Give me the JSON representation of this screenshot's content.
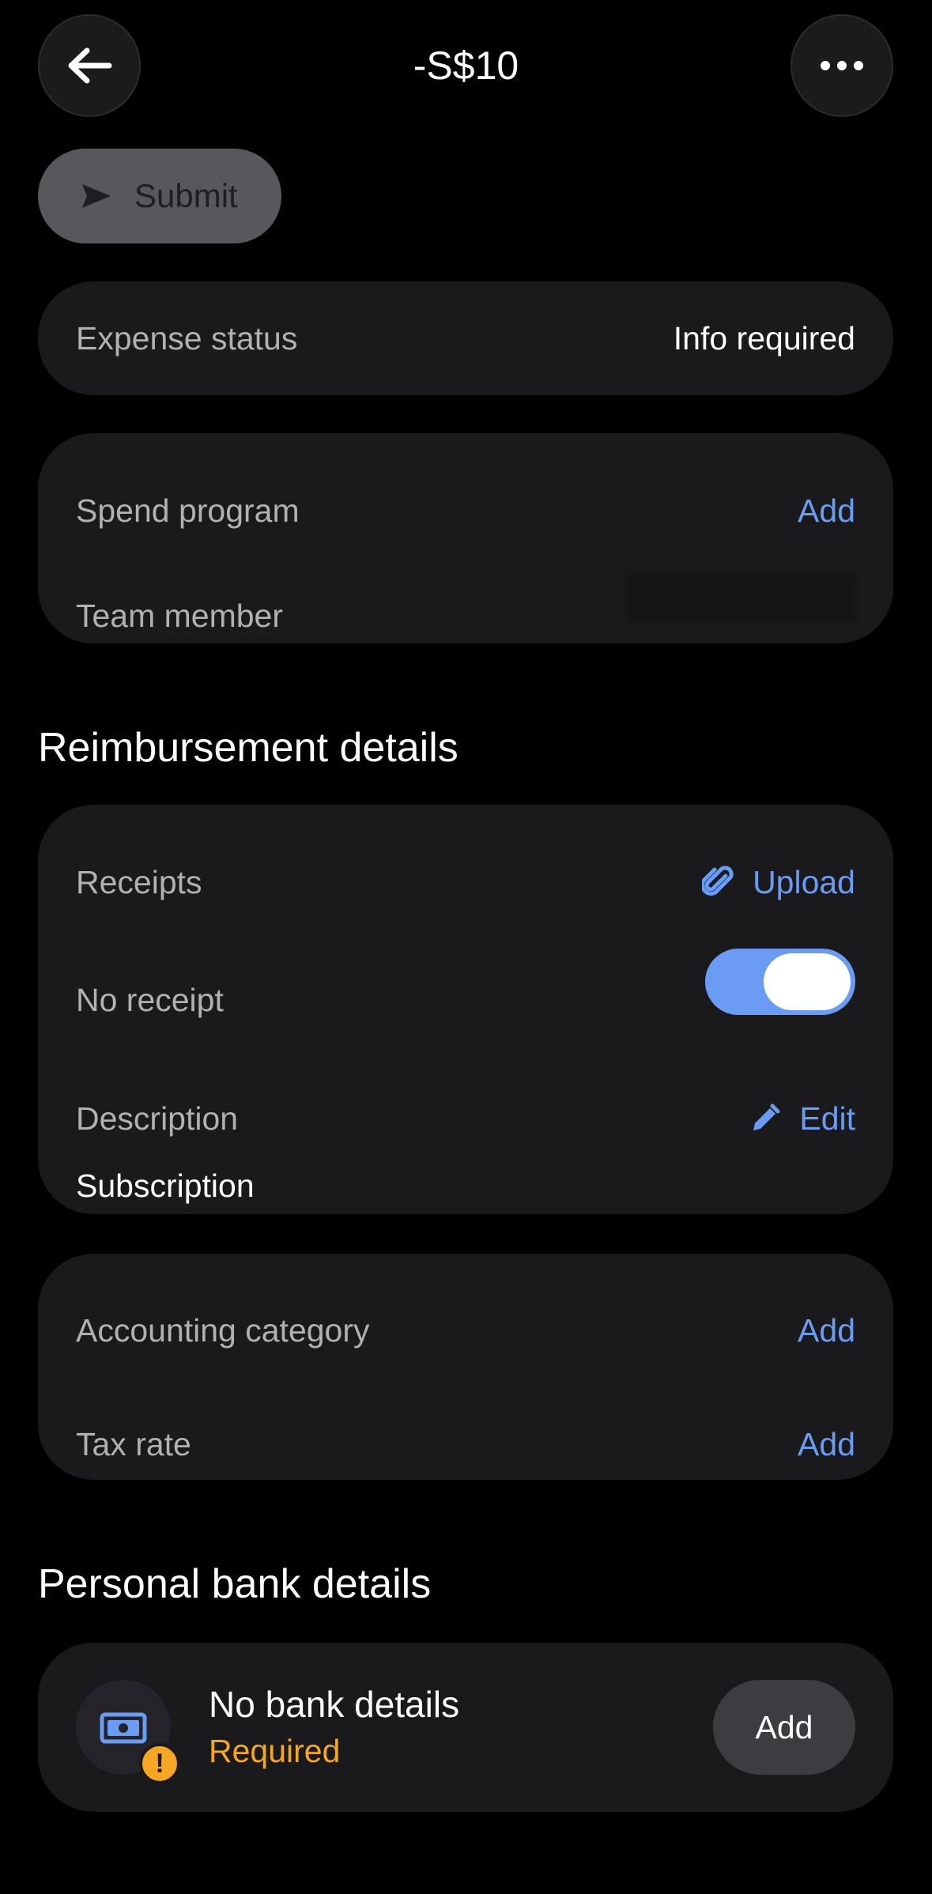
{
  "header": {
    "amount": "-S$10",
    "back_icon": "arrow-left-icon",
    "more_icon": "more-horizontal-icon"
  },
  "submit": {
    "label": "Submit",
    "icon": "send-icon"
  },
  "status_card": {
    "label": "Expense status",
    "value": "Info required"
  },
  "program_card": {
    "spend_program_label": "Spend program",
    "spend_program_action": "Add",
    "team_member_label": "Team member"
  },
  "reimbursement": {
    "title": "Reimbursement details",
    "receipts_label": "Receipts",
    "receipts_action": "Upload",
    "no_receipt_label": "No receipt",
    "no_receipt_on": true,
    "description_label": "Description",
    "description_action": "Edit",
    "description_value": "Subscription"
  },
  "accounting_card": {
    "category_label": "Accounting category",
    "category_action": "Add",
    "tax_label": "Tax rate",
    "tax_action": "Add"
  },
  "bank": {
    "title": "Personal bank details",
    "item_title": "No bank details",
    "item_status": "Required",
    "action": "Add",
    "warning_symbol": "!"
  },
  "colors": {
    "background": "#000000",
    "card": "#1a1a1d",
    "accent": "#6b9cf4",
    "warning": "#f5a623"
  }
}
